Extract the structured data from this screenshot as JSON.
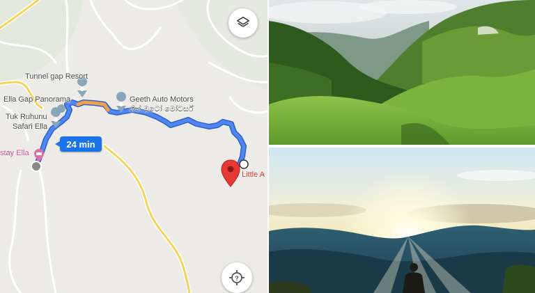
{
  "map": {
    "places": {
      "tunnel_gap": "Tunnel gap Resort",
      "ella_gap": "Ella Gap Panorama",
      "tuk_line1": "Tuk Ruhunu",
      "tuk_line2": "Safari Ella",
      "geeth_line1": "Geeth Auto Motors",
      "geeth_line2": "ගීත් ඔටෝ මෝටර්ස්",
      "stay": "stay Ella",
      "little": "Little A"
    },
    "route_time": "24 min",
    "icons": {
      "layers": "layers-icon",
      "recenter": "my-location-icon",
      "destination": "red-pin-icon",
      "hotel": "hotel-pin-icon"
    },
    "colors": {
      "route": "#4f86f7",
      "traffic": "#f0a050",
      "destination": "#e53935",
      "road": "#f5d35b"
    }
  },
  "photos": {
    "top": "green-hills-valley",
    "bottom": "sunrise-over-mountains"
  }
}
